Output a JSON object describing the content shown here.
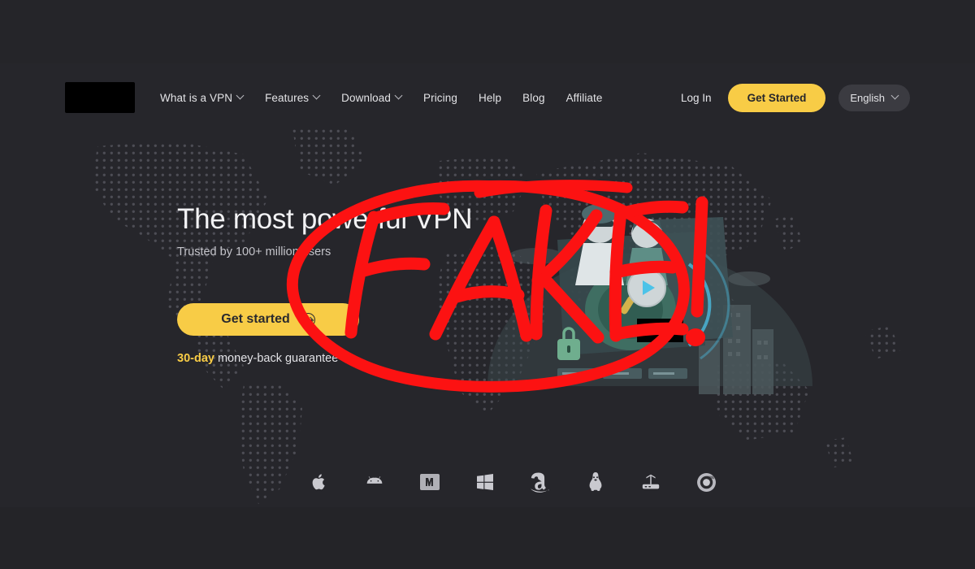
{
  "site": {
    "background_color": "#26262b",
    "accent_color": "#f8cc46",
    "annotation_color": "#ff0f0f",
    "logo_redacted": true
  },
  "nav": {
    "items": [
      {
        "label": "What is a VPN",
        "has_dropdown": true
      },
      {
        "label": "Features",
        "has_dropdown": true
      },
      {
        "label": "Download",
        "has_dropdown": true
      },
      {
        "label": "Pricing",
        "has_dropdown": false
      },
      {
        "label": "Help",
        "has_dropdown": false
      },
      {
        "label": "Blog",
        "has_dropdown": false
      },
      {
        "label": "Affiliate",
        "has_dropdown": false
      }
    ],
    "login_label": "Log In",
    "get_started_label": "Get Started",
    "language_label": "English"
  },
  "hero": {
    "title": "The most powerful VPN",
    "subtitle": "Trusted by 100+ million users",
    "cta_label": "Get started",
    "cta_icon": "arrow-right-circle-icon",
    "guarantee_highlight": "30-day",
    "guarantee_text": " money-back guarantee",
    "media_play_icon": "play-icon",
    "illustration_redacted": true
  },
  "platforms": [
    {
      "name": "apple-icon",
      "label": "Apple"
    },
    {
      "name": "android-icon",
      "label": "Android"
    },
    {
      "name": "mac-icon",
      "label": "Mac"
    },
    {
      "name": "windows-icon",
      "label": "Windows"
    },
    {
      "name": "amazon-icon",
      "label": "Amazon"
    },
    {
      "name": "linux-icon",
      "label": "Linux"
    },
    {
      "name": "router-icon",
      "label": "Router"
    },
    {
      "name": "chrome-icon",
      "label": "Chrome"
    }
  ],
  "annotation": {
    "text": "FAKE!",
    "shape": "hand-drawn ellipse with FAKE! written inside",
    "color": "#ff0f0f"
  }
}
